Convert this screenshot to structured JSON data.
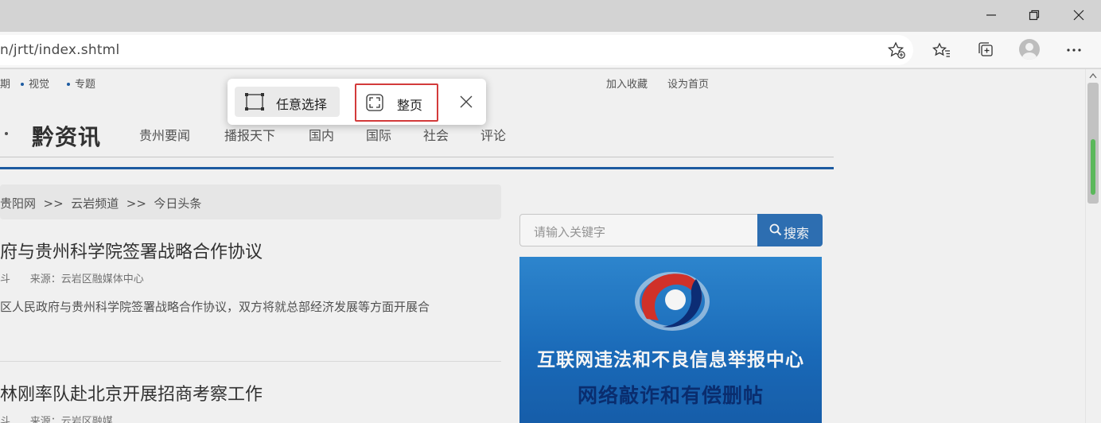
{
  "browser": {
    "address": "n/jrtt/index.shtml",
    "icons": [
      "minimize-icon",
      "restore-icon",
      "close-icon",
      "add-favorite-icon",
      "favorites-icon",
      "collections-icon",
      "profile-icon",
      "more-icon"
    ]
  },
  "page": {
    "top_links_left": [
      "期",
      "视觉",
      "专题"
    ],
    "top_links_right": [
      "加入收藏",
      "设为首页"
    ],
    "brand": "黔资讯",
    "nav": [
      "贵州要闻",
      "播报天下",
      "国内",
      "国际",
      "社会",
      "评论"
    ],
    "breadcrumb": "贵阳网  >>  云岩频道  >>  今日头条",
    "articles": [
      {
        "title": "府与贵州科学院签署战略合作协议",
        "meta": "斗      来源：云岩区融媒体中心",
        "summary": "区人民政府与贵州科学院签署战略合作协议，双方将就总部经济发展等方面开展合"
      },
      {
        "title": "林刚率队赴北京开展招商考察工作",
        "meta": "斗      来源：云岩区融媒"
      }
    ],
    "search": {
      "placeholder": "请输入关键字",
      "button": "搜索"
    },
    "banner": {
      "line1": "互联网违法和不良信息举报中心",
      "line2": "网络敲诈和有偿删帖"
    }
  },
  "capture_popup": {
    "free_select": "任意选择",
    "full_page": "整页"
  },
  "colors": {
    "accent_blue": "#1f5fa8",
    "search_button": "#2f73b9",
    "highlight_red": "#d33a3a"
  }
}
